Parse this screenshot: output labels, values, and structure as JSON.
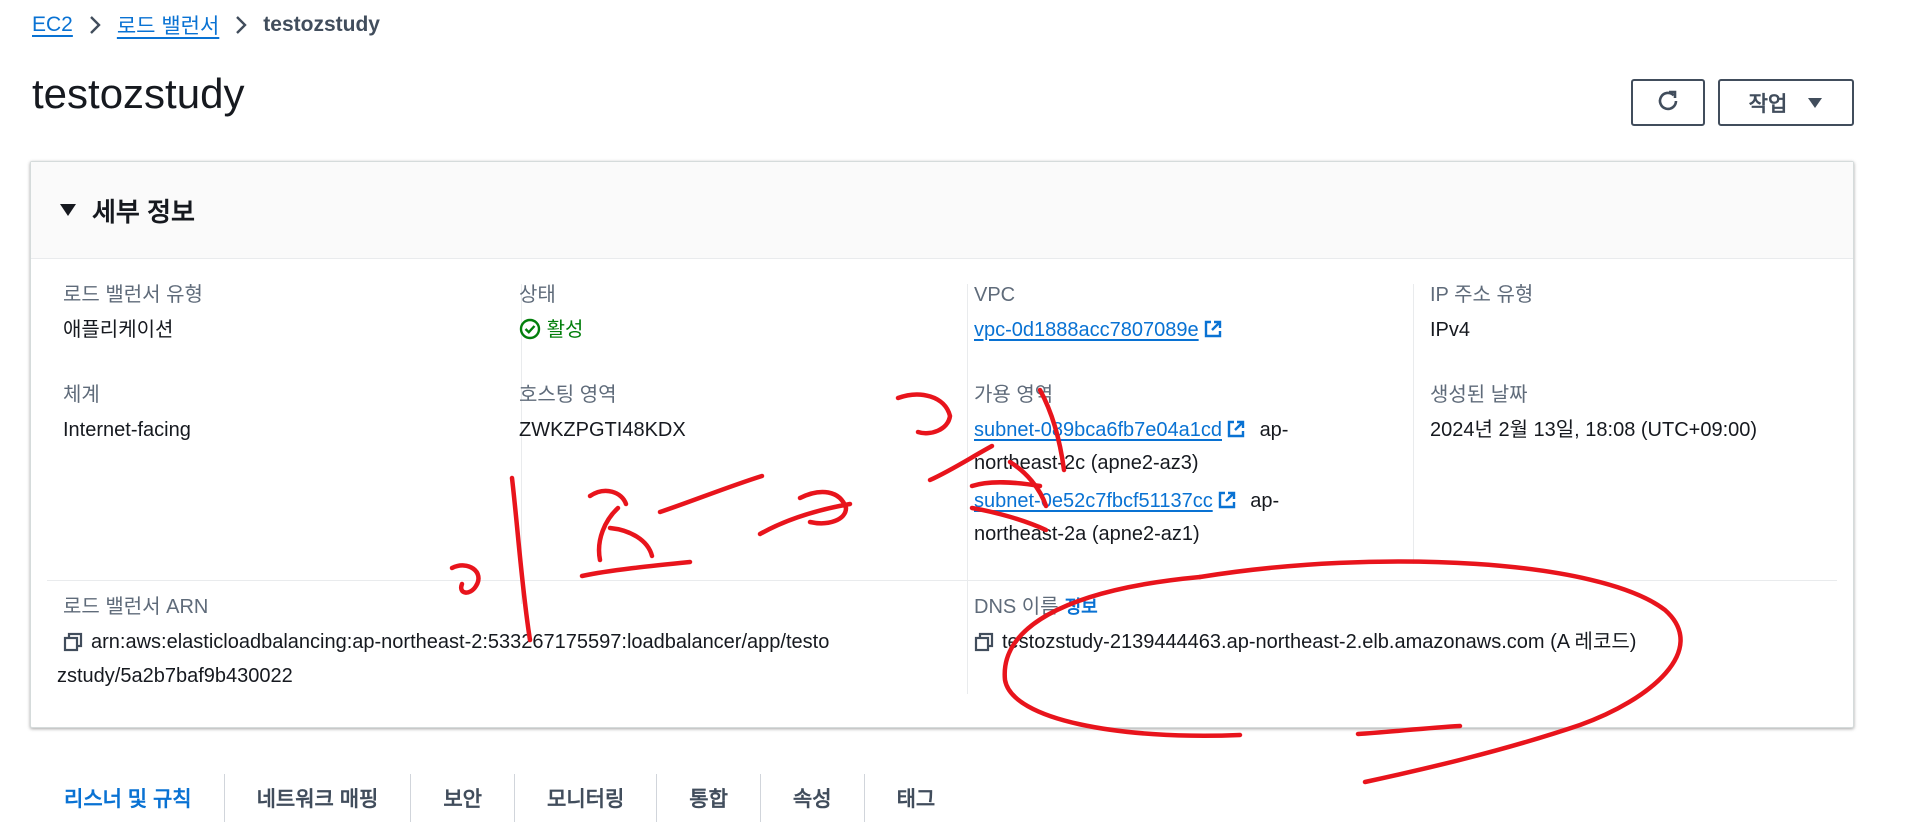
{
  "breadcrumb": {
    "ec2": "EC2",
    "load_balancers": "로드 밸런서",
    "current": "testozstudy"
  },
  "page": {
    "title": "testozstudy"
  },
  "toolbar": {
    "actions_label": "작업"
  },
  "details": {
    "section_title": "세부 정보",
    "lb_type": {
      "label": "로드 밸런서 유형",
      "value": "애플리케이션"
    },
    "status": {
      "label": "상태",
      "value": "활성"
    },
    "vpc": {
      "label": "VPC",
      "value": "vpc-0d1888acc7807089e"
    },
    "ip_type": {
      "label": "IP 주소 유형",
      "value": "IPv4"
    },
    "scheme": {
      "label": "체계",
      "value": "Internet-facing"
    },
    "hosted_zone": {
      "label": "호스팅 영역",
      "value": "ZWKZPGTI48KDX"
    },
    "availability_zones": {
      "label": "가용 영역",
      "subnets": [
        {
          "id": "subnet-089bca6fb7e04a1cd",
          "zone_prefix": "ap-",
          "zone_rest": "northeast-2c (apne2-az3)"
        },
        {
          "id": "subnet-0e52c7fbcf51137cc",
          "zone_prefix": "ap-",
          "zone_rest": "northeast-2a (apne2-az1)"
        }
      ]
    },
    "created": {
      "label": "생성된 날짜",
      "value": "2024년 2월 13일, 18:08 (UTC+09:00)"
    },
    "arn": {
      "label": "로드 밸런서 ARN",
      "line1": "arn:aws:elasticloadbalancing:ap-northeast-2:533267175597:loadbalancer/app/testo",
      "line2": "zstudy/5a2b7baf9b430022"
    },
    "dns": {
      "label": "DNS 이름",
      "info": "정보",
      "value": "testozstudy-2139444463.ap-northeast-2.elb.amazonaws.com (A 레코드)"
    }
  },
  "tabs": [
    "리스너 및 규칙",
    "네트워크 매핑",
    "보안",
    "모니터링",
    "통합",
    "속성",
    "태그"
  ],
  "colors": {
    "link": "#0972d3",
    "success": "#037f0c",
    "annotation": "#e8141c"
  },
  "icons": [
    "chevron-right-icon",
    "refresh-icon",
    "caret-down-icon",
    "check-circle-icon",
    "external-link-icon",
    "copy-icon"
  ]
}
